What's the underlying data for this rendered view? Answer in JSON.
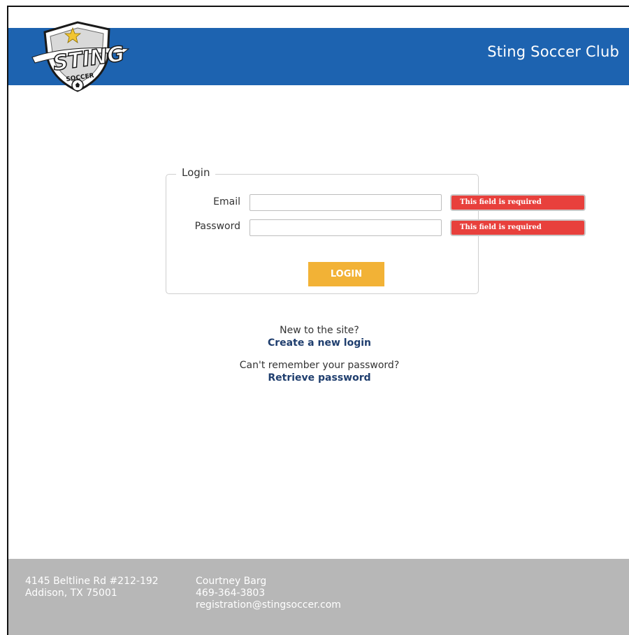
{
  "header": {
    "site_title": "Sting Soccer Club",
    "logo_text": "STING",
    "logo_subtext": "SOCCER"
  },
  "login": {
    "legend": "Login",
    "email_label": "Email",
    "email_value": "",
    "password_label": "Password",
    "password_value": "",
    "email_error": "This field is required",
    "password_error": "This field is required",
    "button_label": "LOGIN"
  },
  "links": {
    "new_prompt": "New to the site?",
    "create_link": "Create a new login",
    "forgot_prompt": "Can't remember your password?",
    "retrieve_link": "Retrieve password"
  },
  "footer": {
    "address_line1": "4145 Beltline Rd #212-192",
    "address_line2": "Addison, TX 75001",
    "contact_name": "Courtney Barg",
    "contact_phone": "469-364-3803",
    "contact_email": "registration@stingsoccer.com"
  },
  "colors": {
    "header_bg": "#1d63b0",
    "button_bg": "#f2b236",
    "error_bg": "#e8403c",
    "footer_bg": "#b7b7b7",
    "link": "#1f3e6e"
  }
}
